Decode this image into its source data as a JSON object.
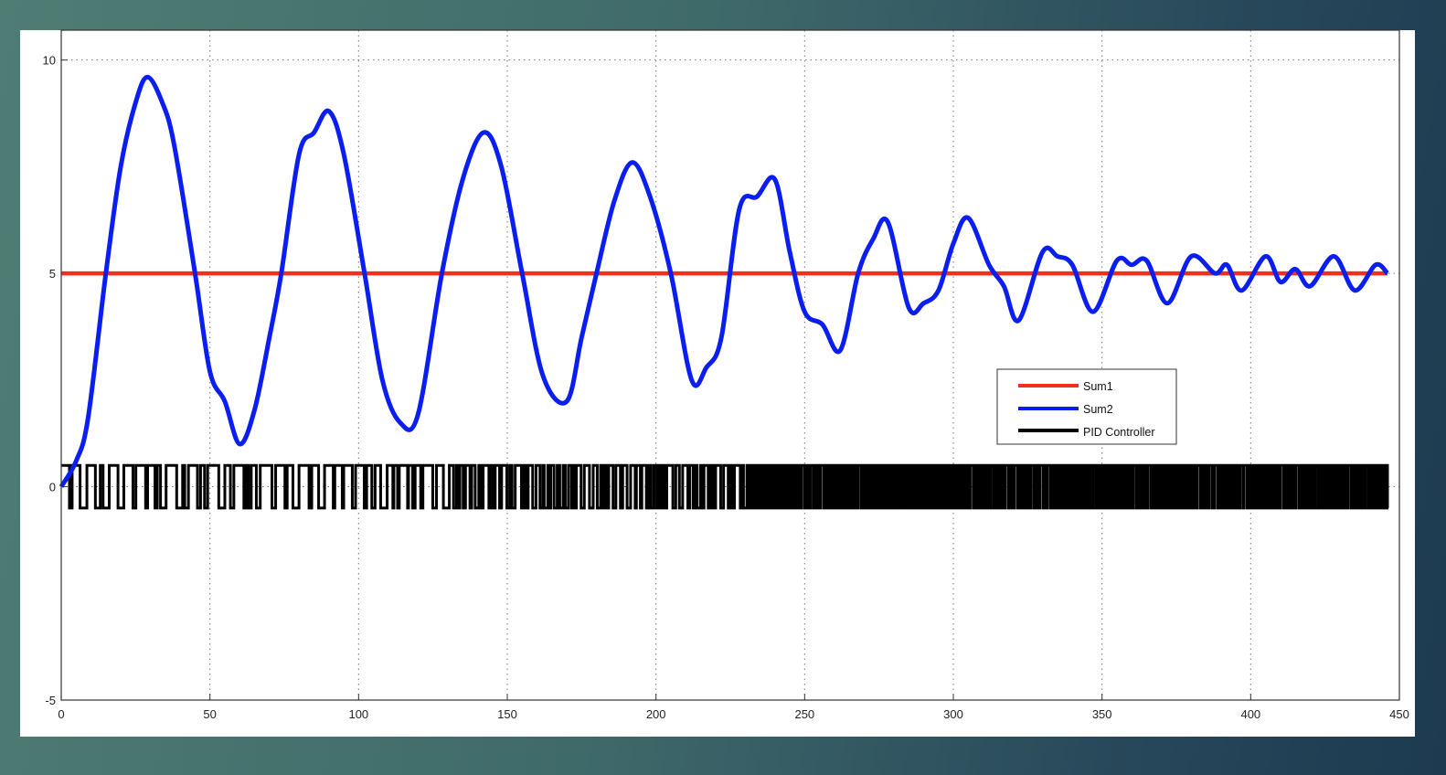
{
  "chart_data": {
    "type": "line",
    "title": "",
    "xlabel": "",
    "ylabel": "",
    "xlim": [
      0,
      450
    ],
    "ylim": [
      -5,
      10.7
    ],
    "xticks": [
      "0",
      "50",
      "100",
      "150",
      "200",
      "250",
      "300",
      "350",
      "400",
      "450"
    ],
    "yticks": [
      "-5",
      "0",
      "5",
      "10"
    ],
    "grid": true,
    "legend_position": "center-right",
    "series": [
      {
        "name": "Sum1",
        "color": "#f0301e",
        "x": [
          0,
          446
        ],
        "y": [
          5,
          5
        ]
      },
      {
        "name": "Sum2",
        "color": "#0a1ef0",
        "x": [
          0,
          5,
          9,
          15,
          20,
          25,
          29,
          34,
          38,
          45,
          50,
          55,
          60,
          65,
          70,
          74,
          80,
          85,
          90,
          95,
          102,
          108,
          114,
          120,
          128,
          135,
          142,
          148,
          155,
          162,
          170,
          175,
          180,
          186,
          192,
          198,
          205,
          212,
          217,
          222,
          228,
          234,
          240,
          245,
          250,
          256,
          262,
          268,
          273,
          278,
          285,
          290,
          295,
          300,
          305,
          312,
          317,
          322,
          330,
          335,
          340,
          347,
          355,
          360,
          365,
          372,
          380,
          388,
          392,
          397,
          405,
          410,
          415,
          420,
          428,
          435,
          442,
          446
        ],
        "y": [
          0,
          0.6,
          1.6,
          5,
          7.5,
          9,
          9.6,
          9,
          8,
          5,
          2.7,
          2,
          1,
          1.8,
          3.5,
          5,
          7.8,
          8.3,
          8.8,
          7.8,
          5,
          2.5,
          1.5,
          1.7,
          5,
          7.2,
          8.3,
          7.5,
          5,
          2.6,
          2.0,
          3.5,
          5,
          6.7,
          7.6,
          6.8,
          5,
          2.5,
          2.8,
          3.5,
          6.5,
          6.8,
          7.2,
          5.5,
          4.1,
          3.8,
          3.2,
          5,
          5.8,
          6.2,
          4.2,
          4.3,
          4.6,
          5.7,
          6.3,
          5.2,
          4.7,
          3.9,
          5.5,
          5.4,
          5.2,
          4.1,
          5.3,
          5.2,
          5.3,
          4.3,
          5.4,
          5.0,
          5.2,
          4.6,
          5.4,
          4.8,
          5.1,
          4.7,
          5.4,
          4.6,
          5.2,
          5.0
        ]
      },
      {
        "name": "PID Controller",
        "color": "#000000",
        "levels": [
          -0.5,
          0.5
        ],
        "x_end": 446
      }
    ]
  }
}
